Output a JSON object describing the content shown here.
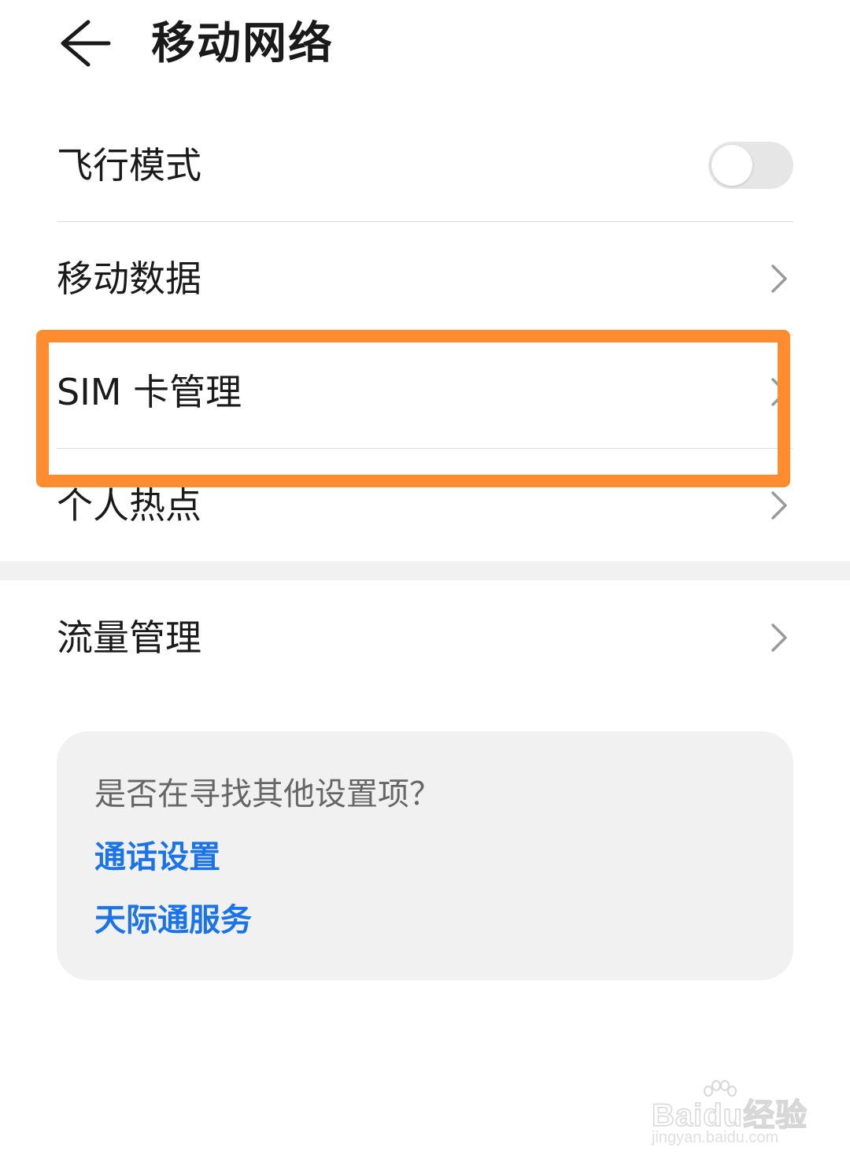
{
  "header": {
    "title": "移动网络",
    "back_icon": "arrow-left-icon"
  },
  "settings": {
    "airplane_mode": {
      "label": "飞行模式",
      "enabled": false
    },
    "mobile_data": {
      "label": "移动数据",
      "icon": "chevron-right-icon"
    },
    "sim_management": {
      "label": "SIM 卡管理",
      "icon": "chevron-right-icon"
    },
    "hotspot": {
      "label": "个人热点",
      "icon": "chevron-right-icon"
    },
    "data_usage": {
      "label": "流量管理",
      "icon": "chevron-right-icon"
    }
  },
  "suggestions": {
    "title": "是否在寻找其他设置项？",
    "links": [
      "通话设置",
      "天际通服务"
    ]
  },
  "annotation": {
    "highlight_color": "#ff8c2f",
    "highlight_target": "SIM 卡管理"
  },
  "watermark": {
    "brand": "Baidu经验",
    "url": "jingyan.baidu.com"
  },
  "colors": {
    "link": "#1a73e8",
    "card_bg": "#f1f1f1",
    "toggle_off": "#e6e6e6"
  }
}
